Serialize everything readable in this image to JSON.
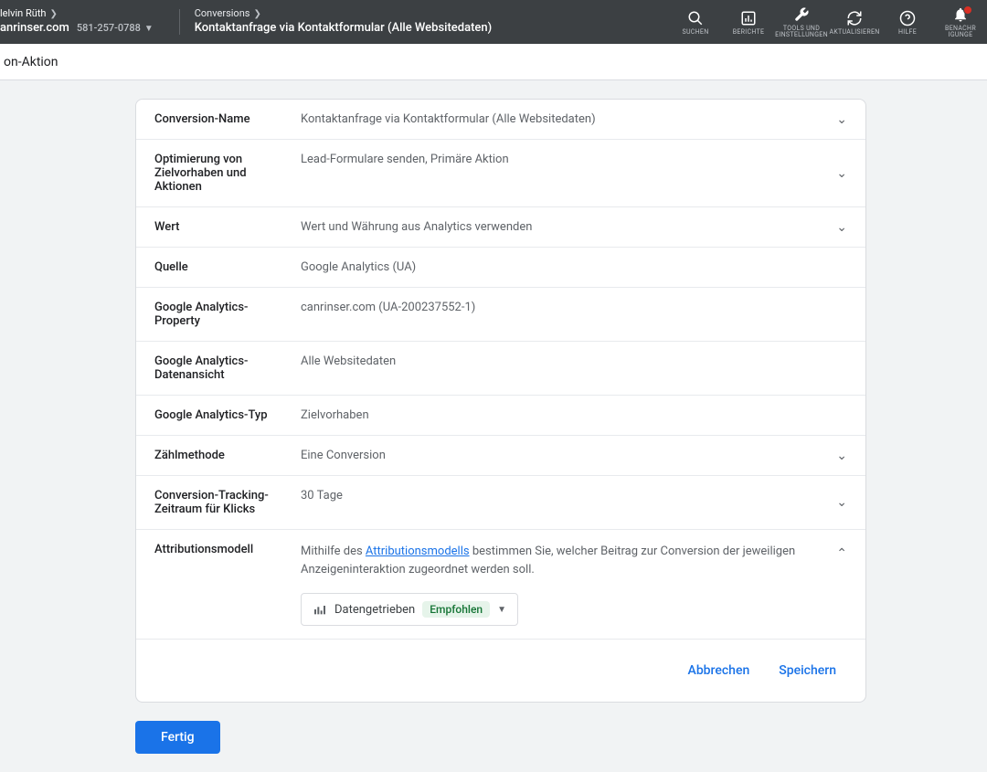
{
  "header": {
    "account_name": "lelvin Rüth",
    "domain": "anrinser.com",
    "phone": "581-257-0788",
    "breadcrumb_top": "Conversions",
    "breadcrumb_bottom": "Kontaktanfrage via Kontaktformular (Alle Websitedaten)",
    "tools": {
      "search": "SUCHEN",
      "reports": "BERICHTE",
      "tools_settings_l1": "TOOLS UND",
      "tools_settings_l2": "EINSTELLUNGEN",
      "refresh": "AKTUALISIEREN",
      "help": "HILFE",
      "notifications_l1": "BENACHR",
      "notifications_l2": "IGUNGE"
    }
  },
  "subheader": {
    "title": "on-Aktion"
  },
  "rows": {
    "conversion_name": {
      "label": "Conversion-Name",
      "value": "Kontaktanfrage via Kontaktformular (Alle Websitedaten)"
    },
    "optimization": {
      "label": "Optimierung von Zielvorhaben und Aktionen",
      "value": "Lead-Formulare senden, Primäre Aktion"
    },
    "value": {
      "label": "Wert",
      "value": "Wert und Währung aus Analytics verwenden"
    },
    "source": {
      "label": "Quelle",
      "value": "Google Analytics (UA)"
    },
    "ga_property": {
      "label": "Google Analytics-Property",
      "value": "canrinser.com (UA-200237552-1)"
    },
    "ga_view": {
      "label": "Google Analytics-Datenansicht",
      "value": "Alle Websitedaten"
    },
    "ga_type": {
      "label": "Google Analytics-Typ",
      "value": "Zielvorhaben"
    },
    "count": {
      "label": "Zählmethode",
      "value": "Eine Conversion"
    },
    "window": {
      "label": "Conversion-Tracking-Zeitraum für Klicks",
      "value": "30 Tage"
    }
  },
  "attribution": {
    "label": "Attributionsmodell",
    "desc_prefix": "Mithilfe des ",
    "link": "Attributionsmodells",
    "desc_suffix": " bestimmen Sie, welcher Beitrag zur Conversion der jeweiligen Anzeigeninteraktion zugeordnet werden soll.",
    "model_name": "Datengetrieben",
    "model_badge": "Empfohlen"
  },
  "actions": {
    "cancel": "Abbrechen",
    "save": "Speichern",
    "done": "Fertig"
  }
}
